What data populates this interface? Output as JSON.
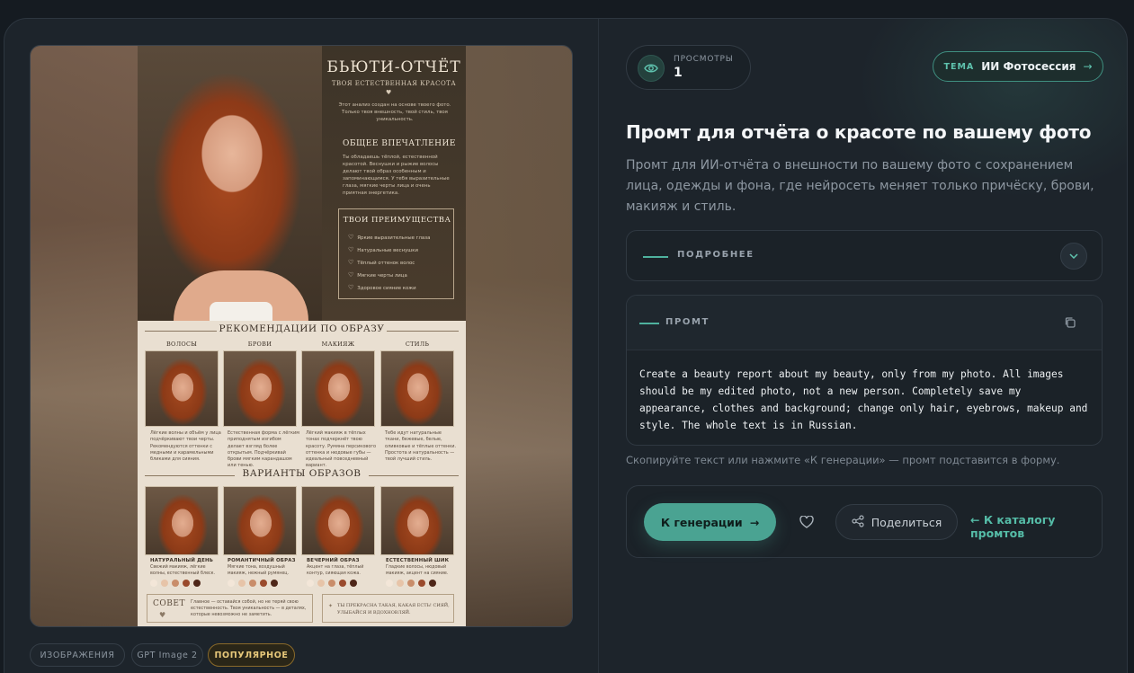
{
  "poster": {
    "title": "БЬЮТИ-ОТЧЁТ",
    "subtitle": "ТВОЯ ЕСТЕСТВЕННАЯ КРАСОТА",
    "intro": "Этот анализ создан на основе твоего фото. Только твоя внешность, твой стиль, твоя уникальность.",
    "impression_title": "ОБЩЕЕ ВПЕЧАТЛЕНИЕ",
    "impression_text": "Ты обладаешь тёплой, естественной красотой. Веснушки и рыжие волосы делают твой образ особенным и запоминающимся. У тебя выразительные глаза, мягкие черты лица и очень приятная энергетика.",
    "advantages_title": "ТВОИ ПРЕИМУЩЕСТВА",
    "advantages": [
      "Яркие выразительные глаза",
      "Натуральные веснушки",
      "Тёплый оттенок волос",
      "Мягкие черты лица",
      "Здоровое сияние кожи"
    ],
    "recommendations_title": "РЕКОМЕНДАЦИИ ПО ОБРАЗУ",
    "rec_columns": [
      {
        "head": "ВОЛОСЫ",
        "text": "Лёгкие волны и объём у лица подчёркивают твои черты. Рекомендуются оттенки с медными и карамельными бликами для сияния."
      },
      {
        "head": "БРОВИ",
        "text": "Естественная форма с лёгким приподнятым изгибом делает взгляд более открытым. Подчёркивай брови мягким карандашом или тенью."
      },
      {
        "head": "МАКИЯЖ",
        "text": "Лёгкий макияж в тёплых тонах подчеркнёт твою красоту. Румяна персикового оттенка и нюдовые губы — идеальный повседневный вариант."
      },
      {
        "head": "СТИЛЬ",
        "text": "Тебе идут натуральные ткани, бежевые, белые, оливковые и тёплые оттенки. Простота и натуральность — твой лучший стиль."
      }
    ],
    "variants_title": "ВАРИАНТЫ ОБРАЗОВ",
    "variants": [
      {
        "head": "НАТУРАЛЬНЫЙ ДЕНЬ",
        "text": "Свежий макияж, лёгкие волны, естественный блеск."
      },
      {
        "head": "РОМАНТИЧНЫЙ ОБРАЗ",
        "text": "Мягкие тона, воздушный макияж, нежный румянец."
      },
      {
        "head": "ВЕЧЕРНИЙ ОБРАЗ",
        "text": "Акцент на глаза, тёплый контур, сияющая кожа."
      },
      {
        "head": "ЕСТЕСТВЕННЫЙ ШИК",
        "text": "Гладкие волосы, нюдовый макияж, акцент на сияние."
      }
    ],
    "swatches": [
      "#f3e6d8",
      "#e7c4a8",
      "#c98d6a",
      "#9a4a2c",
      "#4e2618"
    ],
    "tip_title": "СОВЕТ",
    "tip_text": "Главное — оставайся собой, но не теряй свою естественность. Твоя уникальность — в деталях, которые невозможно не заметить.",
    "closing_text": "ТЫ ПРЕКРАСНА ТАКАЯ, КАКАЯ ЕСТЬ! СИЯЙ, УЛЫБАЙСЯ И ВДОХНОВЛЯЙ."
  },
  "tags": [
    "ИЗОБРАЖЕНИЯ",
    "GPT Image 2",
    "ПОПУЛЯРНОЕ"
  ],
  "views": {
    "label": "ПРОСМОТРЫ",
    "value": "1"
  },
  "theme": {
    "key": "ТЕМА",
    "value": "ИИ Фотосессия",
    "arrow": "→"
  },
  "title": "Промт для отчёта о красоте по вашему фото",
  "description": "Промт для ИИ-отчёта о внешности по вашему фото с сохранением лица, одежды и фона, где нейросеть меняет только причёску, брови, макияж и стиль.",
  "more_label": "ПОДРОБНЕЕ",
  "prompt": {
    "label": "ПРОМТ",
    "text": "Create a beauty report about my beauty, only from my photo. All images should be my edited photo, not a new person. Completely save my appearance, clothes and background; change only hair, eyebrows, makeup and style. The whole text is in Russian."
  },
  "hint": "Скопируйте текст или нажмите «К генерации» — промт подставится в форму.",
  "actions": {
    "generate": "К генерации",
    "generate_arrow": "→",
    "share": "Поделиться",
    "back": "← К каталогу промтов"
  },
  "colors": {
    "accent": "#4aa392",
    "background": "#1d242b",
    "popular": "#e7c87a"
  }
}
